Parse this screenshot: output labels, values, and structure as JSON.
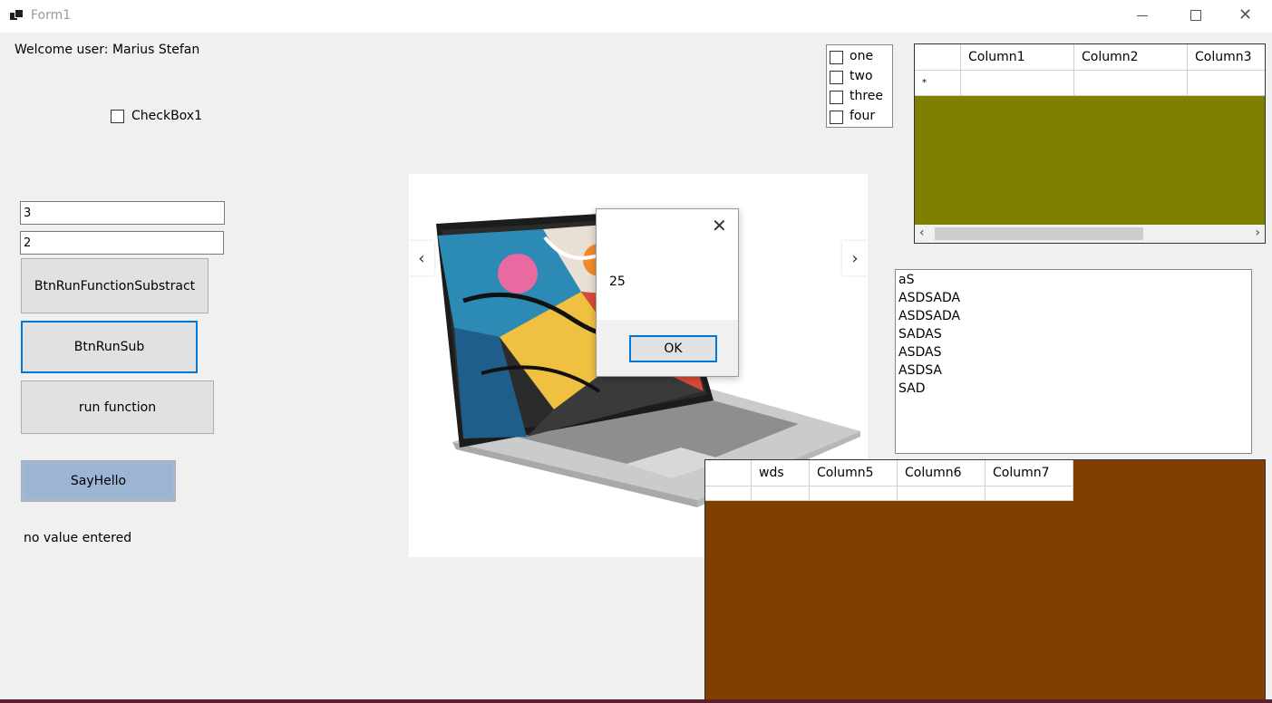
{
  "window": {
    "title": "Form1"
  },
  "welcome_label": "Welcome user: Marius Stefan",
  "checkbox1": {
    "label": "CheckBox1",
    "checked": false
  },
  "inputs": {
    "first_value": "3",
    "second_value": "2"
  },
  "buttons": {
    "substract": "BtnRunFunctionSubstract",
    "run_sub": "BtnRunSub",
    "run_function": "run function",
    "say_hello": "SayHello"
  },
  "status_label": "no value entered",
  "checked_list": {
    "items": [
      {
        "label": "one",
        "checked": false
      },
      {
        "label": "two",
        "checked": false
      },
      {
        "label": "three",
        "checked": false
      },
      {
        "label": "four",
        "checked": false
      }
    ]
  },
  "grid1": {
    "columns": [
      "",
      "Column1",
      "Column2",
      "Column3"
    ],
    "new_row_marker": "*",
    "background": "#808000"
  },
  "list_items": [
    "aS",
    "ASDSADA",
    "ASDSADA",
    "SADAS",
    "ASDAS",
    "ASDSA",
    "SAD"
  ],
  "grid2": {
    "columns": [
      "",
      "wds",
      "Column5",
      "Column6",
      "Column7"
    ],
    "background": "#7f3f00"
  },
  "picture": {
    "prev_icon": "chevron-left-icon",
    "next_icon": "chevron-right-icon"
  },
  "message_box": {
    "text": "25",
    "ok_label": "OK"
  }
}
